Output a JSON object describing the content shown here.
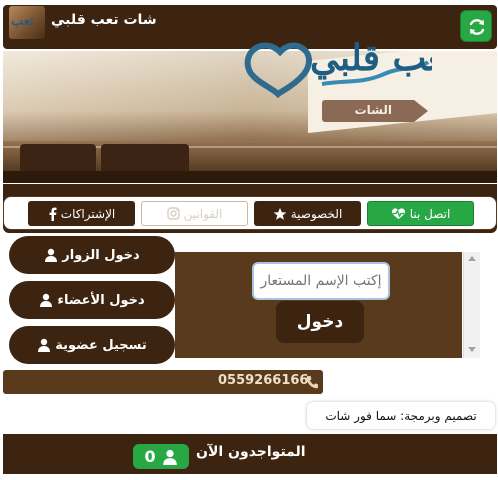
{
  "header": {
    "title": "شات تعب قلبي",
    "logo_text": "تعب",
    "refresh_icon": "refresh-icon"
  },
  "banner": {
    "logo_text": "تعب قلبي",
    "chat_tag": "الشات"
  },
  "nav": {
    "items": [
      {
        "label": "اتصل بنا",
        "icon": "heart-pulse-icon"
      },
      {
        "label": "الخصوصية",
        "icon": "star-icon"
      },
      {
        "label": "القوانين",
        "icon": "instagram-icon"
      },
      {
        "label": "الإشتراكات",
        "icon": "facebook-icon"
      }
    ]
  },
  "side": {
    "visitors_label": "دخول الزوار",
    "members_label": "دخول الأعضاء",
    "register_label": "تسجيل عضوية"
  },
  "login": {
    "nickname_placeholder": "إكتب الإسم المستعار",
    "login_label": "دخول"
  },
  "phone": "0559266166",
  "credits": "تصميم وبرمجة: سما فور شات",
  "online": {
    "label": "المتواجدون الآن",
    "count": "0"
  },
  "colors": {
    "brand_brown": "#3d2410",
    "panel_brown": "#5a3a1c",
    "accent_green": "#27a844"
  }
}
